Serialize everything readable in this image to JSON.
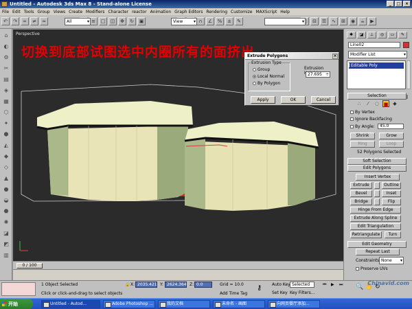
{
  "title": "Untitled - Autodesk 3ds Max 8 - Stand-alone License",
  "window_buttons": [
    "_",
    "□",
    "×"
  ],
  "menu": [
    "File",
    "Edit",
    "Tools",
    "Group",
    "Views",
    "Create",
    "Modifiers",
    "Character",
    "reactor",
    "Animation",
    "Graph Editors",
    "Rendering",
    "Customize",
    "MAXScript",
    "Help"
  ],
  "toolbar": {
    "filter_select": "All",
    "coord_select": "View"
  },
  "viewport": {
    "label": "Perspective",
    "annotation": "切换到底部试图选中内圈所有的面挤出"
  },
  "dialog": {
    "title": "Extrude Polygons",
    "close": "×",
    "group_label": "Extrusion Type",
    "options": [
      "Group",
      "Local Normal",
      "By Polygon"
    ],
    "selected_option": "Local Normal",
    "height_label": "Extrusion Height:",
    "height_value": "27.695",
    "buttons": [
      "Apply",
      "OK",
      "Cancel"
    ]
  },
  "command_panel": {
    "object_name": "Line02",
    "modifier_list": "Modifier List",
    "stack_item": "Editable Poly",
    "selection_header": "Selection",
    "by_vertex": "By Vertex",
    "ignore_backfacing": "Ignore Backfacing",
    "by_angle": "By Angle:",
    "angle_value": "45.0",
    "shrink": "Shrink",
    "grow": "Grow",
    "ring": "Ring",
    "loop": "Loop",
    "selected_info": "52 Polygons Selected",
    "soft_selection": "Soft Selection",
    "edit_polygons": "Edit Polygons",
    "insert_vertex": "Insert Vertex",
    "extrude": "Extrude",
    "outline": "Outline",
    "bevel": "Bevel",
    "inset": "Inset",
    "bridge": "Bridge",
    "flip": "Flip",
    "hinge": "Hinge From Edge",
    "extrude_spline": "Extrude Along Spline",
    "edit_triangulation": "Edit Triangulation",
    "retriangulate": "Retriangulate",
    "turn": "Turn",
    "edit_geometry": "Edit Geometry",
    "repeat_last": "Repeat Last",
    "constraints": "Constraints:",
    "constraints_value": "None",
    "preserve_uvs": "Preserve UVs"
  },
  "timeline": {
    "slider": "0 / 100"
  },
  "status": {
    "objects_selected": "1 Object Selected",
    "prompt": "Click or click-and-drag to select objects",
    "x_label": "X:",
    "x_value": "2035.421",
    "y_label": "Y:",
    "y_value": "2624.364",
    "z_label": "Z:",
    "z_value": "0.0",
    "grid": "Grid = 10.0",
    "add_time_tag": "Add Time Tag",
    "auto_key": "Auto Key",
    "selected": "Selected",
    "set_key": "Set Key",
    "key_filters": "Key Filters..."
  },
  "taskbar": {
    "start": "开始",
    "tasks": [
      "Untitled - Autod...",
      "Adobe Photoshop ...",
      "我的文档",
      "未命名 - 画图",
      "向网页餐厅添加..."
    ]
  },
  "watermark": "Chinavid.com"
}
